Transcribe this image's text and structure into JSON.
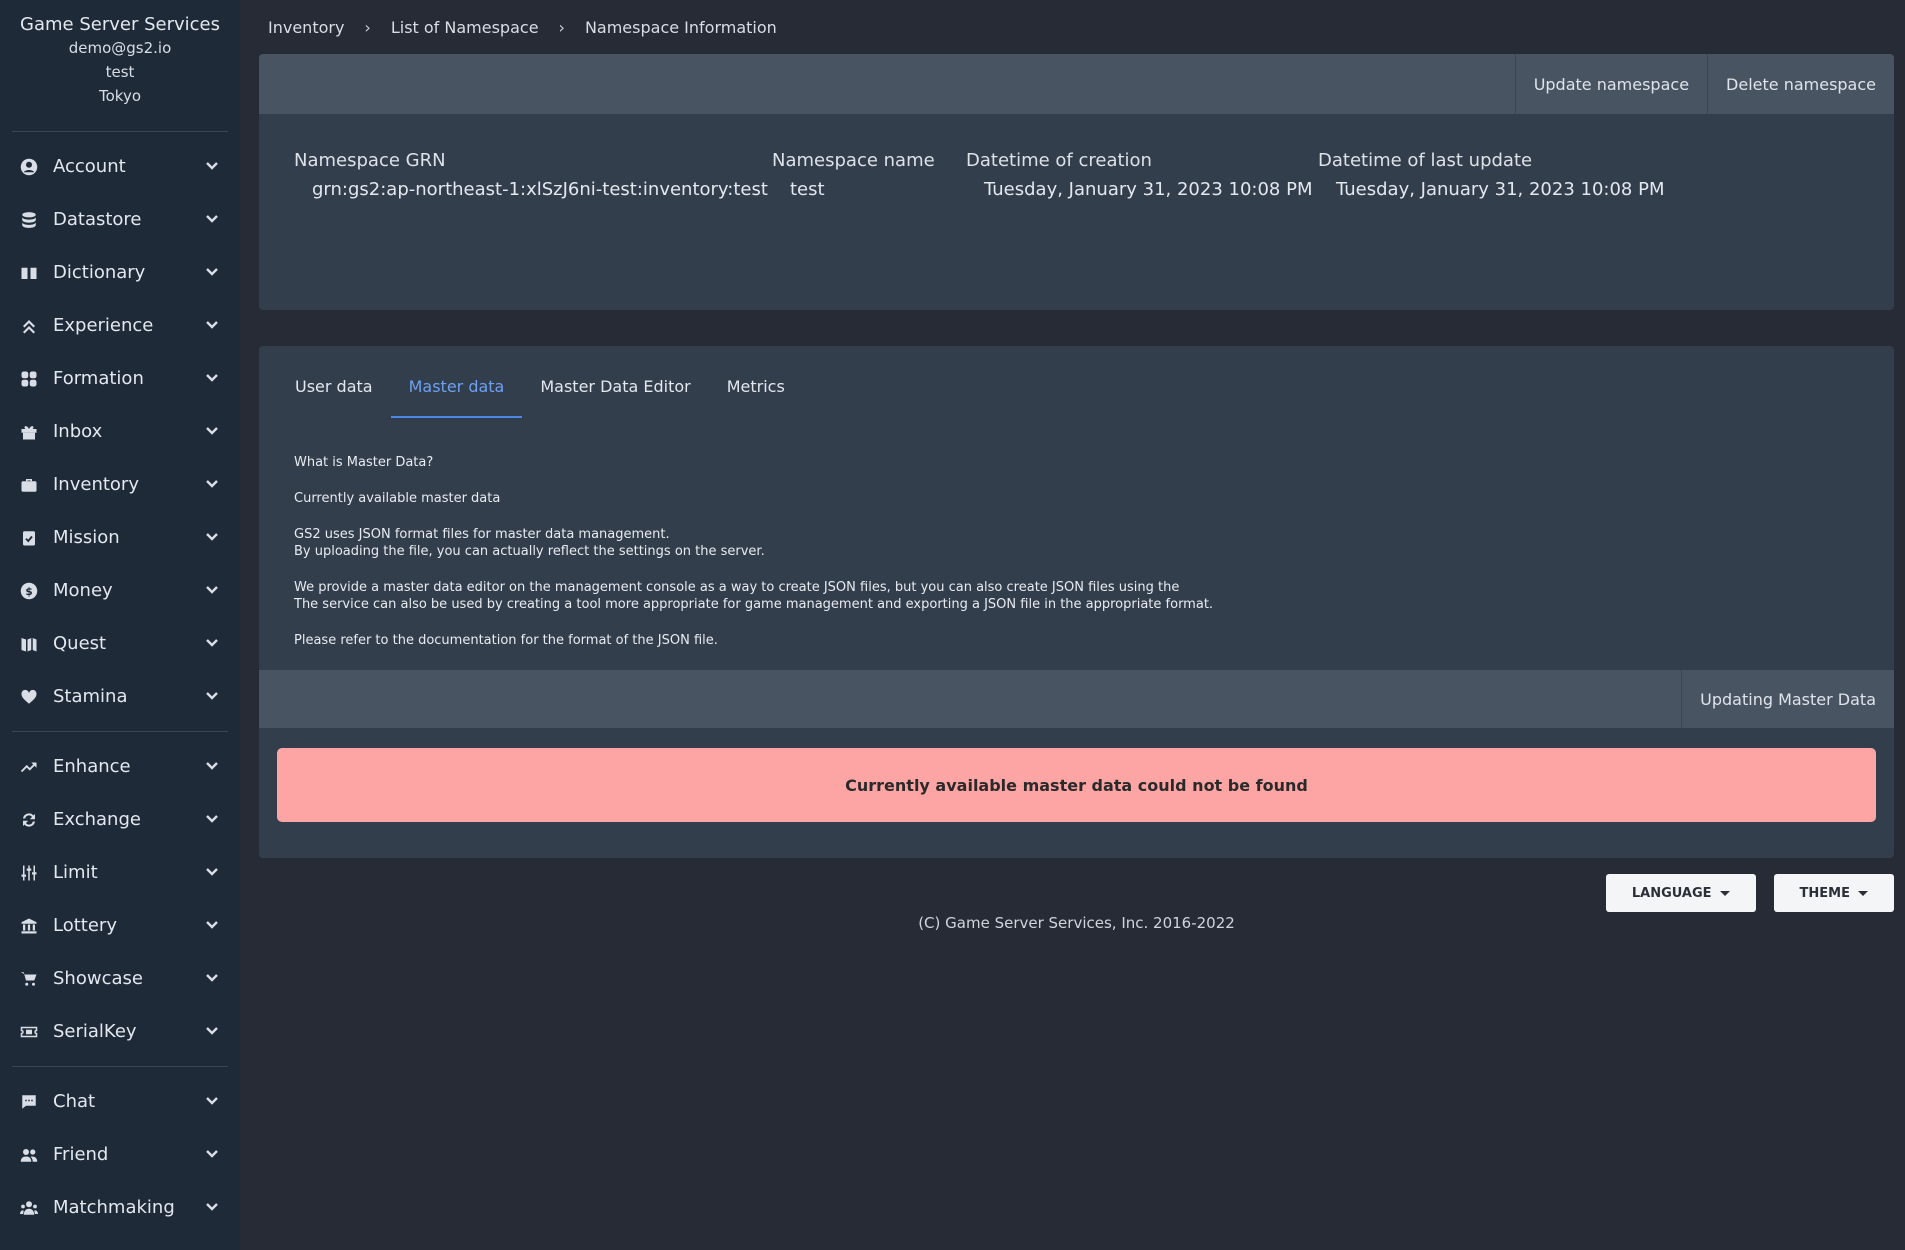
{
  "sidebar": {
    "brand": "Game Server Services",
    "email": "demo@gs2.io",
    "project": "test",
    "region": "Tokyo",
    "groups": [
      [
        {
          "label": "Account",
          "icon": "account-icon"
        },
        {
          "label": "Datastore",
          "icon": "database-icon"
        },
        {
          "label": "Dictionary",
          "icon": "book-icon"
        },
        {
          "label": "Experience",
          "icon": "double-chevron-up-icon"
        },
        {
          "label": "Formation",
          "icon": "grid-icon"
        },
        {
          "label": "Inbox",
          "icon": "gift-icon"
        },
        {
          "label": "Inventory",
          "icon": "briefcase-icon"
        },
        {
          "label": "Mission",
          "icon": "clipboard-check-icon"
        },
        {
          "label": "Money",
          "icon": "coin-icon"
        },
        {
          "label": "Quest",
          "icon": "map-icon"
        },
        {
          "label": "Stamina",
          "icon": "heart-icon"
        }
      ],
      [
        {
          "label": "Enhance",
          "icon": "trending-up-icon"
        },
        {
          "label": "Exchange",
          "icon": "exchange-icon"
        },
        {
          "label": "Limit",
          "icon": "sliders-icon"
        },
        {
          "label": "Lottery",
          "icon": "bank-icon"
        },
        {
          "label": "Showcase",
          "icon": "cart-icon"
        },
        {
          "label": "SerialKey",
          "icon": "ticket-icon"
        }
      ],
      [
        {
          "label": "Chat",
          "icon": "chat-icon"
        },
        {
          "label": "Friend",
          "icon": "friends-icon"
        },
        {
          "label": "Matchmaking",
          "icon": "users-icon"
        }
      ]
    ]
  },
  "breadcrumb": [
    "Inventory",
    "List of Namespace",
    "Namespace Information"
  ],
  "namespace_toolbar": {
    "update": "Update namespace",
    "delete": "Delete namespace"
  },
  "namespace": {
    "grn_label": "Namespace GRN",
    "grn_value": "grn:gs2:ap-northeast-1:xlSzJ6ni-test:inventory:test",
    "name_label": "Namespace name",
    "name_value": "test",
    "created_label": "Datetime of creation",
    "created_value": "Tuesday, January 31, 2023 10:08 PM",
    "updated_label": "Datetime of last update",
    "updated_value": "Tuesday, January 31, 2023 10:08 PM"
  },
  "tabs": [
    {
      "label": "User data",
      "active": false
    },
    {
      "label": "Master data",
      "active": true
    },
    {
      "label": "Master Data Editor",
      "active": false
    },
    {
      "label": "Metrics",
      "active": false
    }
  ],
  "master": {
    "what_is": "What is Master Data?",
    "currently_available": "Currently available master data",
    "p1_l1": "GS2 uses JSON format files for master data management.",
    "p1_l2": "By uploading the file, you can actually reflect the settings on the server.",
    "p2_l1": "We provide a master data editor on the management console as a way to create JSON files, but you can also create JSON files using the",
    "p2_l2": "The service can also be used by creating a tool more appropriate for game management and exporting a JSON file in the appropriate format.",
    "p3": "Please refer to the documentation for the format of the JSON file.",
    "update_button": "Updating Master Data",
    "alert": "Currently available master data could not be found"
  },
  "footer": {
    "language": "LANGUAGE",
    "theme": "THEME",
    "copyright": "(C) Game Server Services, Inc. 2016-2022"
  }
}
